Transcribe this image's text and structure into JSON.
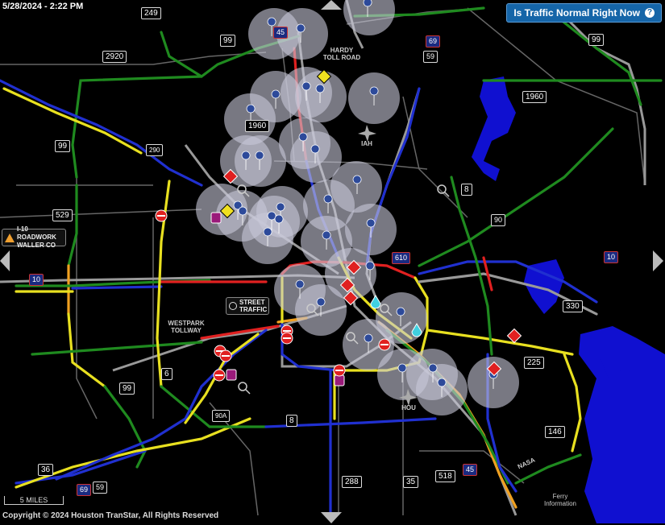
{
  "header": {
    "timestamp": "5/28/2024 - 2:22 PM",
    "traffic_button": "Is Traffic Normal Right Now",
    "help_icon": "?"
  },
  "footer": {
    "copyright": "Copyright © 2024 Houston TranStar, All Rights Reserved",
    "scale": "5 MILES"
  },
  "incident_card": {
    "line1": "I-10 ROADWORK",
    "line2": "WALLER CO"
  },
  "street_card": {
    "line1": "STREET",
    "line2": "TRAFFIC"
  },
  "labels": {
    "hardy_toll": [
      "HARDY",
      "TOLL ROAD"
    ],
    "iah": "IAH",
    "hou": "HOU",
    "westpark": [
      "WESTPARK",
      "TOLLWAY"
    ],
    "nasa": "NASA",
    "ferry": [
      "Ferry",
      "Information"
    ]
  },
  "route_signs": [
    {
      "id": "249",
      "text": "249"
    },
    {
      "id": "99a",
      "text": "99"
    },
    {
      "id": "2920",
      "text": "2920"
    },
    {
      "id": "99b",
      "text": "99"
    },
    {
      "id": "1960a",
      "text": "1960"
    },
    {
      "id": "1960b",
      "text": "1960"
    },
    {
      "id": "99c",
      "text": "99"
    },
    {
      "id": "529",
      "text": "529"
    },
    {
      "id": "8a",
      "text": "8"
    },
    {
      "id": "6",
      "text": "6"
    },
    {
      "id": "99d",
      "text": "99"
    },
    {
      "id": "8b",
      "text": "8"
    },
    {
      "id": "36",
      "text": "36"
    },
    {
      "id": "288",
      "text": "288"
    },
    {
      "id": "35",
      "text": "35"
    },
    {
      "id": "518",
      "text": "518"
    },
    {
      "id": "330",
      "text": "330"
    },
    {
      "id": "225",
      "text": "225"
    },
    {
      "id": "146",
      "text": "146"
    },
    {
      "id": "90a",
      "text": "90A"
    },
    {
      "id": "290",
      "text": "290"
    },
    {
      "id": "90",
      "text": "90"
    }
  ],
  "interstate_shields": [
    {
      "id": "i45n",
      "text": "45"
    },
    {
      "id": "i69n",
      "text": "69"
    },
    {
      "id": "us59n",
      "text": "59"
    },
    {
      "id": "i10w",
      "text": "10"
    },
    {
      "id": "i610",
      "text": "610"
    },
    {
      "id": "i10e",
      "text": "10"
    },
    {
      "id": "i45s",
      "text": "45"
    },
    {
      "id": "i69s",
      "text": "69"
    },
    {
      "id": "us59s",
      "text": "59"
    }
  ],
  "colors": {
    "fast": "#1f8a1f",
    "moderate": "#e8e020",
    "slow": "#f0a020",
    "stopped": "#e02020",
    "roadwork": "#2030d0",
    "none": "#777777",
    "camera_pin": "#3050a0",
    "water": "#1010d0",
    "highlight": "#ffffff"
  }
}
